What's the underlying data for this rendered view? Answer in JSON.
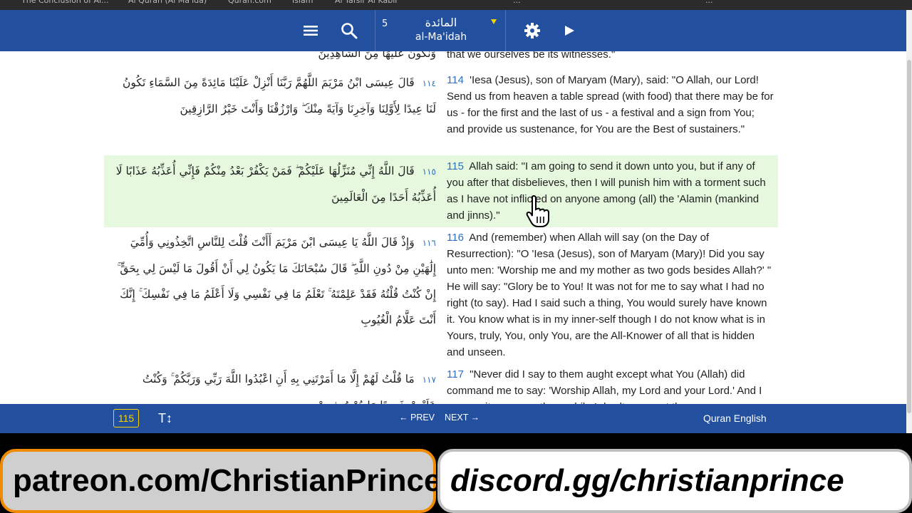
{
  "browser_tabs": [
    "The Conclusion of Al...",
    "Al Quran (Al Ma'ida)",
    "Quran.com",
    "Islam",
    "Al Tafsir Al Kabir",
    "...",
    "..."
  ],
  "header": {
    "menu_icon": "hamburger-menu-icon",
    "search_icon": "search-icon",
    "surah_number": "5",
    "surah_arabic": "المائدة",
    "surah_latin": "al-Ma'idah",
    "settings_icon": "gear-icon",
    "play_icon": "play-icon",
    "accent": "#23509e",
    "caret_color": "#f5d300"
  },
  "partial_top": {
    "arabic": "وَنَكُونَ عَلَيْهَا مِنَ الشَّاهِدِينَ",
    "english": "that we ourselves be its witnesses.\""
  },
  "verses": [
    {
      "number": "114",
      "arabic_number": "١١٤",
      "arabic": "قَالَ عِيسَى ابْنُ مَرْيَمَ اللَّهُمَّ رَبَّنَا أَنْزِلْ عَلَيْنَا مَائِدَةً مِنَ السَّمَاءِ تَكُونُ لَنَا عِيدًا لِأَوَّلِنَا وَآخِرِنَا وَآيَةً مِنْكَ ۖ وَارْزُقْنَا وَأَنْتَ خَيْرُ الرَّازِقِينَ",
      "english": "'Iesa (Jesus), son of Maryam (Mary), said: \"O Allah, our Lord! Send us from heaven a table spread (with food) that there may be for us - for the first and the last of us - a festival and a sign from You; and provide us sustenance, for You are the Best of sustainers.\""
    },
    {
      "number": "115",
      "arabic_number": "١١٥",
      "arabic": "قَالَ اللَّهُ إِنِّي مُنَزِّلُهَا عَلَيْكُمْ ۖ فَمَنْ يَكْفُرْ بَعْدُ مِنْكُمْ فَإِنِّي أُعَذِّبُهُ عَذَابًا لَا أُعَذِّبُهُ أَحَدًا مِنَ الْعَالَمِينَ",
      "english": "Allah said: \"I am going to send it down unto you, but if any of you after that disbelieves, then I will punish him with a torment such as I have not inflicted on anyone among (all) the 'Alamin (mankind and jinns).\""
    },
    {
      "number": "116",
      "arabic_number": "١١٦",
      "arabic": "وَإِذْ قَالَ اللَّهُ يَا عِيسَى ابْنَ مَرْيَمَ أَأَنْتَ قُلْتَ لِلنَّاسِ اتَّخِذُونِي وَأُمِّيَ إِلَٰهَيْنِ مِنْ دُونِ اللَّهِ ۖ قَالَ سُبْحَانَكَ مَا يَكُونُ لِي أَنْ أَقُولَ مَا لَيْسَ لِي بِحَقٍّ ۚ إِنْ كُنْتُ قُلْتُهُ فَقَدْ عَلِمْتَهُ ۚ تَعْلَمُ مَا فِي نَفْسِي وَلَا أَعْلَمُ مَا فِي نَفْسِكَ ۚ إِنَّكَ أَنْتَ عَلَّامُ الْغُيُوبِ",
      "english": "And (remember) when Allah will say (on the Day of Resurrection): \"O 'Iesa (Jesus), son of Maryam (Mary)! Did you say unto men: 'Worship me and my mother as two gods besides Allah?' \" He will say: \"Glory be to You! It was not for me to say what I had no right (to say). Had I said such a thing, You would surely have known it. You know what is in my inner-self though I do not know what is in Yours, truly, You, only You, are the All-Knower of all that is hidden and unseen."
    },
    {
      "number": "117",
      "arabic_number": "١١٧",
      "arabic": "مَا قُلْتُ لَهُمْ إِلَّا مَا أَمَرْتَنِي بِهِ أَنِ اعْبُدُوا اللَّهَ رَبِّي وَرَبَّكُمْ ۚ وَكُنْتُ عَلَيْهِمْ شَهِيدًا مَا دُمْتُ فِيهِمْ",
      "english": "\"Never did I say to them aught except what You (Allah) did command me to say: 'Worship Allah, my Lord and your Lord.' And I was a witness over them while I dwelt amongst them"
    }
  ],
  "highlight_color": "#e6f8de",
  "bottom_bar": {
    "current_verse": "115",
    "text_size_icon": "text-size-icon",
    "text_size_label": "T↕",
    "prev_label": "PREV",
    "next_label": "NEXT",
    "translation": "Quran English"
  },
  "banners": {
    "left": "patreon.com/ChristianPrince",
    "right": "discord.gg/christianprince"
  }
}
